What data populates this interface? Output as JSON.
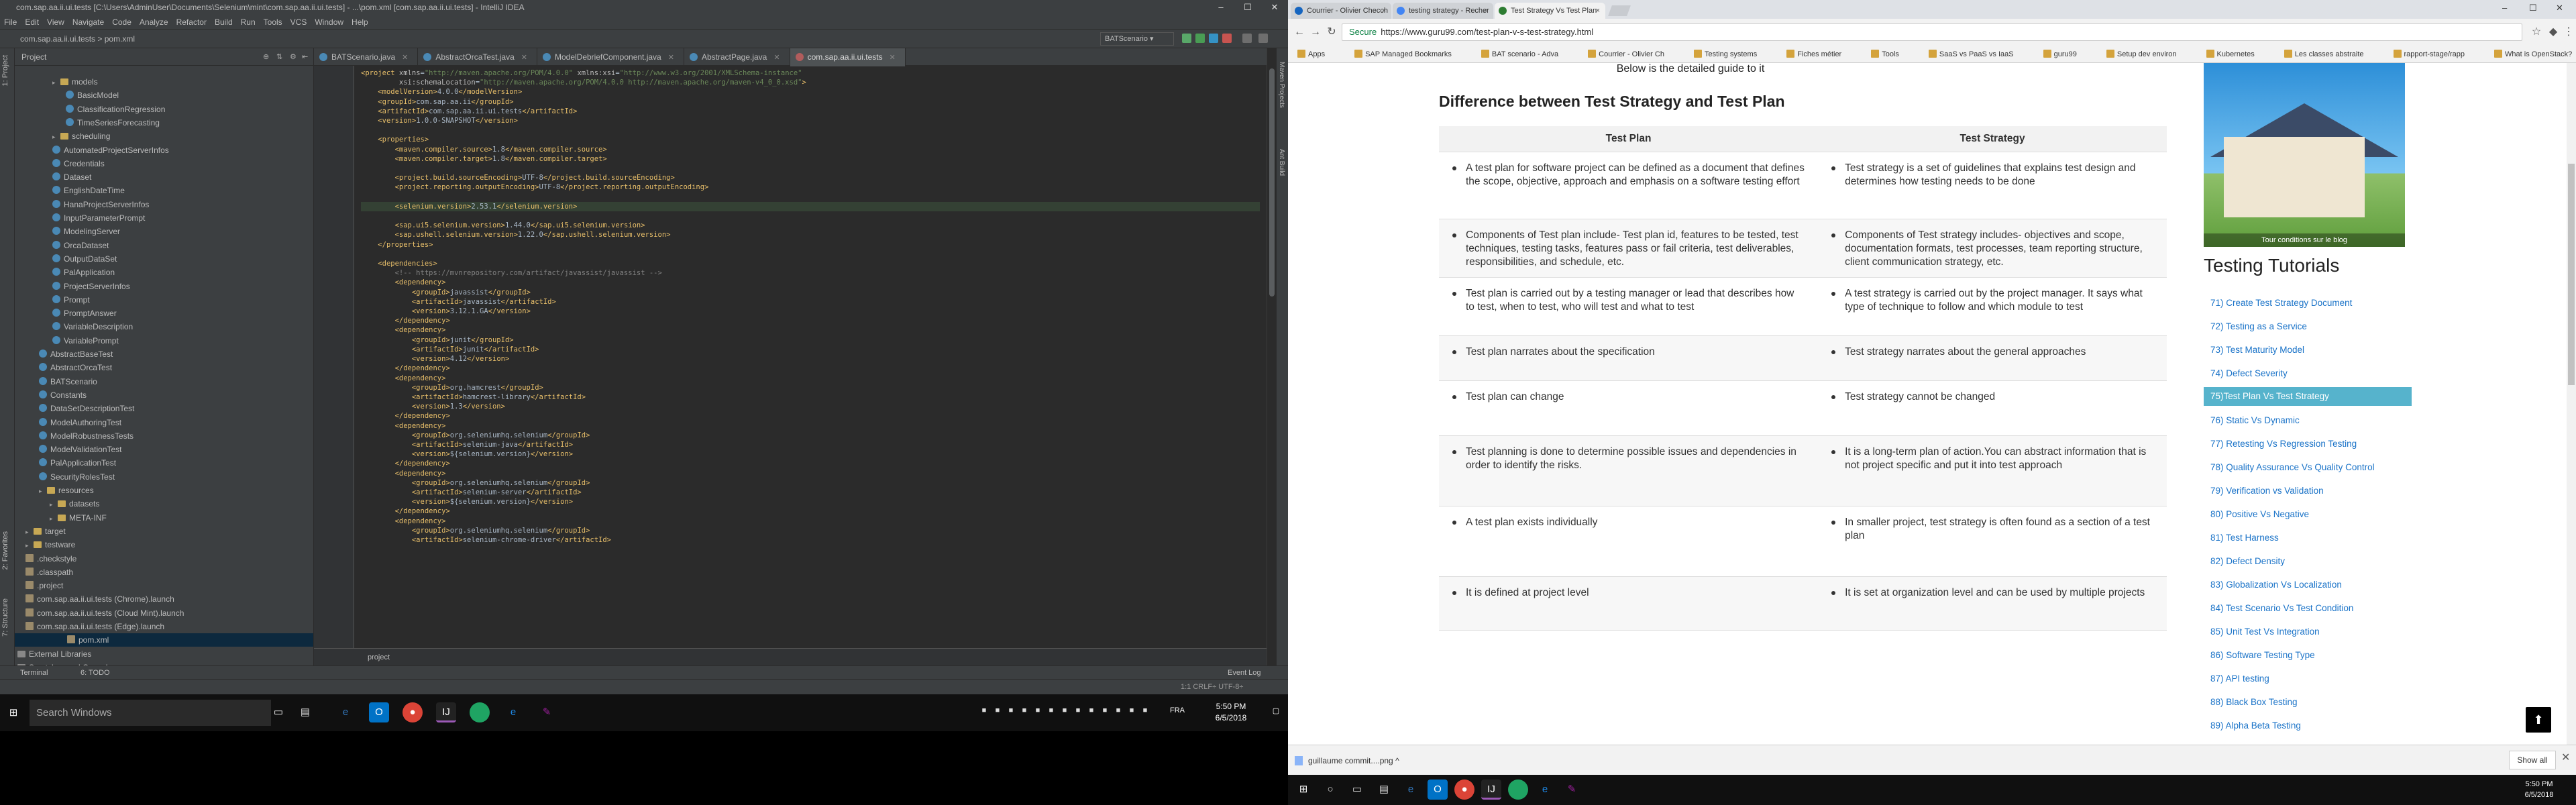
{
  "ide": {
    "title": "com.sap.aa.ii.ui.tests [C:\\Users\\AdminUser\\Documents\\Selenium\\mint\\com.sap.aa.ii.ui.tests] - ...\\pom.xml [com.sap.aa.ii.ui.tests] - IntelliJ IDEA",
    "menu": [
      "File",
      "Edit",
      "View",
      "Navigate",
      "Code",
      "Analyze",
      "Refactor",
      "Build",
      "Run",
      "Tools",
      "VCS",
      "Window",
      "Help"
    ],
    "nav_breadcrumb": "com.sap.aa.ii.ui.tests  >  pom.xml",
    "run_config": "BATScenario",
    "project_label": "Project",
    "tree": [
      {
        "label": "models",
        "type": "folder"
      },
      {
        "label": "BasicModel",
        "type": "class"
      },
      {
        "label": "ClassificationRegression",
        "type": "class"
      },
      {
        "label": "TimeSeriesForecasting",
        "type": "class"
      },
      {
        "label": "scheduling",
        "type": "folder"
      },
      {
        "label": "AutomatedProjectServerInfos",
        "type": "class"
      },
      {
        "label": "Credentials",
        "type": "class"
      },
      {
        "label": "Dataset",
        "type": "class"
      },
      {
        "label": "EnglishDateTime",
        "type": "class"
      },
      {
        "label": "HanaProjectServerInfos",
        "type": "class"
      },
      {
        "label": "InputParameterPrompt",
        "type": "class"
      },
      {
        "label": "ModelingServer",
        "type": "class"
      },
      {
        "label": "OrcaDataset",
        "type": "class"
      },
      {
        "label": "OutputDataSet",
        "type": "class"
      },
      {
        "label": "PalApplication",
        "type": "class"
      },
      {
        "label": "ProjectServerInfos",
        "type": "class"
      },
      {
        "label": "Prompt",
        "type": "class"
      },
      {
        "label": "PromptAnswer",
        "type": "class"
      },
      {
        "label": "VariableDescription",
        "type": "class"
      },
      {
        "label": "VariablePrompt",
        "type": "class"
      },
      {
        "label": "AbstractBaseTest",
        "type": "class"
      },
      {
        "label": "AbstractOrcaTest",
        "type": "class"
      },
      {
        "label": "BATScenario",
        "type": "class"
      },
      {
        "label": "Constants",
        "type": "class"
      },
      {
        "label": "DataSetDescriptionTest",
        "type": "class"
      },
      {
        "label": "ModelAuthoringTest",
        "type": "class"
      },
      {
        "label": "ModelRobustnessTests",
        "type": "class"
      },
      {
        "label": "ModelValidationTest",
        "type": "class"
      },
      {
        "label": "PalApplicationTest",
        "type": "class"
      },
      {
        "label": "SecurityRolesTest",
        "type": "class"
      },
      {
        "label": "resources",
        "type": "folder"
      },
      {
        "label": "datasets",
        "type": "folder"
      },
      {
        "label": "META-INF",
        "type": "folder"
      },
      {
        "label": "target",
        "type": "folder"
      },
      {
        "label": "testware",
        "type": "folder"
      },
      {
        "label": ".checkstyle",
        "type": "file"
      },
      {
        "label": ".classpath",
        "type": "file"
      },
      {
        "label": ".project",
        "type": "file"
      },
      {
        "label": "com.sap.aa.ii.ui.tests (Chrome).launch",
        "type": "file"
      },
      {
        "label": "com.sap.aa.ii.ui.tests (Cloud Mint).launch",
        "type": "file"
      },
      {
        "label": "com.sap.aa.ii.ui.tests (Edge).launch",
        "type": "file"
      },
      {
        "label": "pom.xml",
        "type": "file"
      },
      {
        "label": "External Libraries",
        "type": "lib"
      },
      {
        "label": "Scratches and Consoles",
        "type": "lib"
      }
    ],
    "tabs": [
      "BATScenario.java",
      "AbstractOrcaTest.java",
      "ModelDebriefComponent.java",
      "AbstractPage.java",
      "com.sap.aa.ii.ui.tests"
    ],
    "code_lines": [
      "<project xmlns=\"http://maven.apache.org/POM/4.0.0\" xmlns:xsi=\"http://www.w3.org/2001/XMLSchema-instance\"",
      "         xsi:schemaLocation=\"http://maven.apache.org/POM/4.0.0 http://maven.apache.org/maven-v4_0_0.xsd\">",
      "    <modelVersion>4.0.0</modelVersion>",
      "    <groupId>com.sap.aa.ii</groupId>",
      "    <artifactId>com.sap.aa.ii.ui.tests</artifactId>",
      "    <version>1.0.0-SNAPSHOT</version>",
      "",
      "    <properties>",
      "        <maven.compiler.source>1.8</maven.compiler.source>",
      "        <maven.compiler.target>1.8</maven.compiler.target>",
      "",
      "        <project.build.sourceEncoding>UTF-8</project.build.sourceEncoding>",
      "        <project.reporting.outputEncoding>UTF-8</project.reporting.outputEncoding>",
      "",
      "        <selenium.version>2.53.1</selenium.version>",
      "",
      "        <sap.ui5.selenium.version>1.44.0</sap.ui5.selenium.version>",
      "        <sap.ushell.selenium.version>1.22.0</sap.ushell.selenium.version>",
      "    </properties>",
      "",
      "    <dependencies>",
      "        <!-- https://mvnrepository.com/artifact/javassist/javassist -->",
      "        <dependency>",
      "            <groupId>javassist</groupId>",
      "            <artifactId>javassist</artifactId>",
      "            <version>3.12.1.GA</version>",
      "        </dependency>",
      "        <dependency>",
      "            <groupId>junit</groupId>",
      "            <artifactId>junit</artifactId>",
      "            <version>4.12</version>",
      "        </dependency>",
      "        <dependency>",
      "            <groupId>org.hamcrest</groupId>",
      "            <artifactId>hamcrest-library</artifactId>",
      "            <version>1.3</version>",
      "        </dependency>",
      "        <dependency>",
      "            <groupId>org.seleniumhq.selenium</groupId>",
      "            <artifactId>selenium-java</artifactId>",
      "            <version>${selenium.version}</version>",
      "        </dependency>",
      "        <dependency>",
      "            <groupId>org.seleniumhq.selenium</groupId>",
      "            <artifactId>selenium-server</artifactId>",
      "            <version>${selenium.version}</version>",
      "        </dependency>",
      "        <dependency>",
      "            <groupId>org.seleniumhq.selenium</groupId>",
      "            <artifactId>selenium-chrome-driver</artifactId>"
    ],
    "breadcrumb_bottom": "project",
    "tool_tabs": [
      "Terminal",
      "6: TODO"
    ],
    "event_log": "Event Log",
    "status_right": "1:1  CRLF÷  UTF-8÷",
    "left_strip": [
      "1: Project",
      "2: Favorites",
      "7: Structure"
    ],
    "right_strip": [
      "Maven Projects",
      "Ant Build"
    ]
  },
  "taskbar_left": {
    "search_placeholder": "Search Windows",
    "lang": "FRA",
    "time": "5:50 PM",
    "date": "6/5/2018"
  },
  "browser": {
    "tabs": [
      {
        "label": "Courrier - Olivier Checch",
        "color": "#1565c0"
      },
      {
        "label": "testing strategy - Recher",
        "color": "#4285f4"
      },
      {
        "label": "Test Strategy Vs Test Plan",
        "color": "#2e7d32"
      }
    ],
    "url": "https://www.guru99.com/test-plan-v-s-test-strategy.html",
    "secure_label": "Secure",
    "bookmarks": [
      "Apps",
      "SAP Managed Bookmarks",
      "BAT scenario - Adva",
      "Courrier - Olivier Ch",
      "Testing systems",
      "Fiches métier",
      "Tools",
      "SaaS vs PaaS vs IaaS",
      "guru99",
      "Setup dev environ",
      "Kubernetes",
      "Les classes abstraite",
      "rapport-stage/rapp",
      "What is OpenStack?"
    ],
    "detailed_guide": "Below is the detailed guide to it",
    "heading": "Difference between Test Strategy and Test Plan",
    "col_plan": "Test Plan",
    "col_strategy": "Test Strategy",
    "rows": [
      {
        "plan": "A test plan for software project can be defined as a document that defines the scope, objective, approach and emphasis on a software testing effort",
        "strategy": "Test strategy is a set of guidelines that explains test design and determines how testing needs to be done"
      },
      {
        "plan": "Components of Test plan include- Test plan id, features to be tested, test techniques, testing tasks, features pass or fail criteria, test deliverables, responsibilities, and schedule, etc.",
        "strategy": "Components of Test strategy includes- objectives and scope, documentation formats, test processes, team reporting structure, client communication strategy, etc."
      },
      {
        "plan": "Test plan is carried out by a testing manager or lead that describes how to test, when to test, who will test and what to test",
        "strategy": "A test strategy is carried out by the project manager. It says what type of technique to follow and which module to test"
      },
      {
        "plan": "Test plan narrates about the specification",
        "strategy": "Test strategy narrates about the general approaches"
      },
      {
        "plan": "Test plan can change",
        "strategy": "Test strategy cannot be changed"
      },
      {
        "plan": "Test planning is done to determine possible issues and dependencies in order to identify the risks.",
        "strategy": "It is a long-term plan of action.You can abstract information that is not project specific and put it into test approach"
      },
      {
        "plan": "A test plan exists individually",
        "strategy": "In smaller project, test strategy is often found as a section of a test plan"
      },
      {
        "plan": "It is defined at project level",
        "strategy": "It is set at organization level and can be used by multiple projects"
      }
    ],
    "image_caption": "Tour conditions sur le blog",
    "tutorials_title": "Testing Tutorials",
    "tutorials": [
      "71) Create Test Strategy Document",
      "72) Testing as a Service",
      "73) Test Maturity Model",
      "74) Defect Severity",
      "75)Test Plan Vs Test Strategy",
      "76) Static Vs Dynamic",
      "77) Retesting Vs Regression Testing",
      "78) Quality Assurance Vs Quality Control",
      "79) Verification vs Validation",
      "80) Positive Vs Negative",
      "81) Test Harness",
      "82) Defect Density",
      "83) Globalization Vs Localization",
      "84) Test Scenario Vs Test Condition",
      "85) Unit Test Vs Integration",
      "86) Software Testing Type",
      "87) API testing",
      "88) Black Box Testing",
      "89) Alpha Beta Testing"
    ],
    "tutorials_active_index": 4,
    "download_file": "guillaume commit....png",
    "show_all": "Show all",
    "time": "5:50 PM",
    "date": "6/5/2018"
  }
}
